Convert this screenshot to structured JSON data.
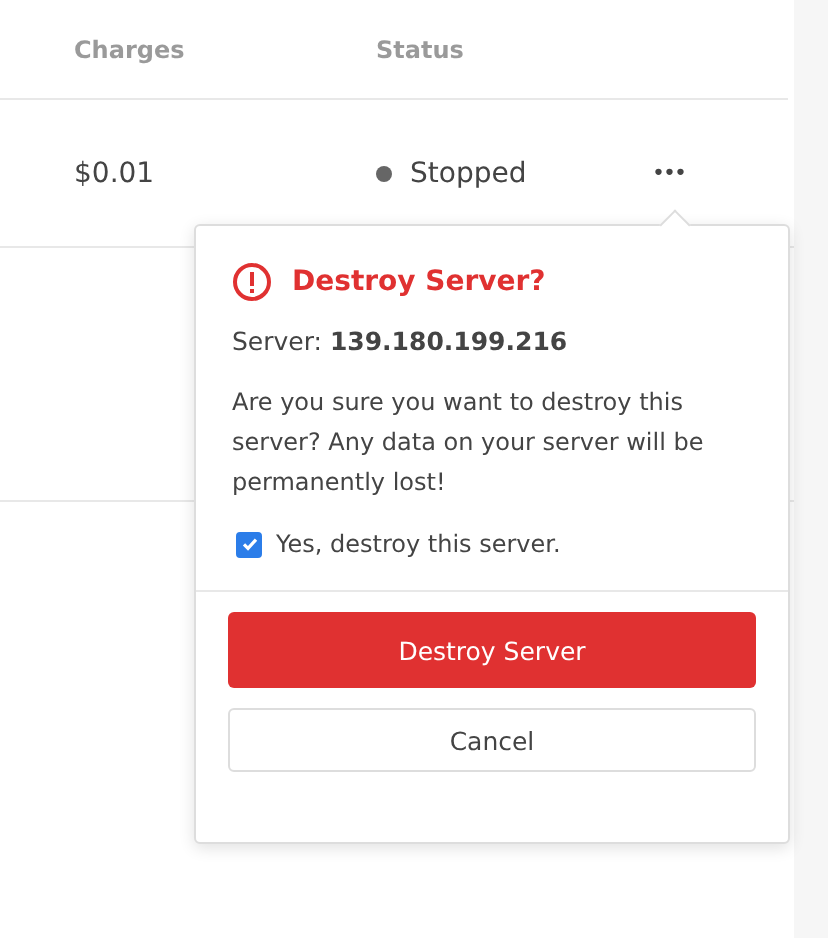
{
  "table": {
    "columns": [
      "Charges",
      "Status"
    ],
    "rows": [
      {
        "charges": "$0.01",
        "status": "Stopped",
        "menu": "•••"
      }
    ]
  },
  "popover": {
    "title": "Destroy Server?",
    "server_label": "Server:",
    "server_value": "139.180.199.216",
    "message": "Are you sure you want to destroy this server? Any data on your server will be permanently lost!",
    "confirm": {
      "label": "Yes, destroy this server.",
      "checked": true
    },
    "buttons": {
      "destroy": "Destroy Server",
      "cancel": "Cancel"
    }
  }
}
